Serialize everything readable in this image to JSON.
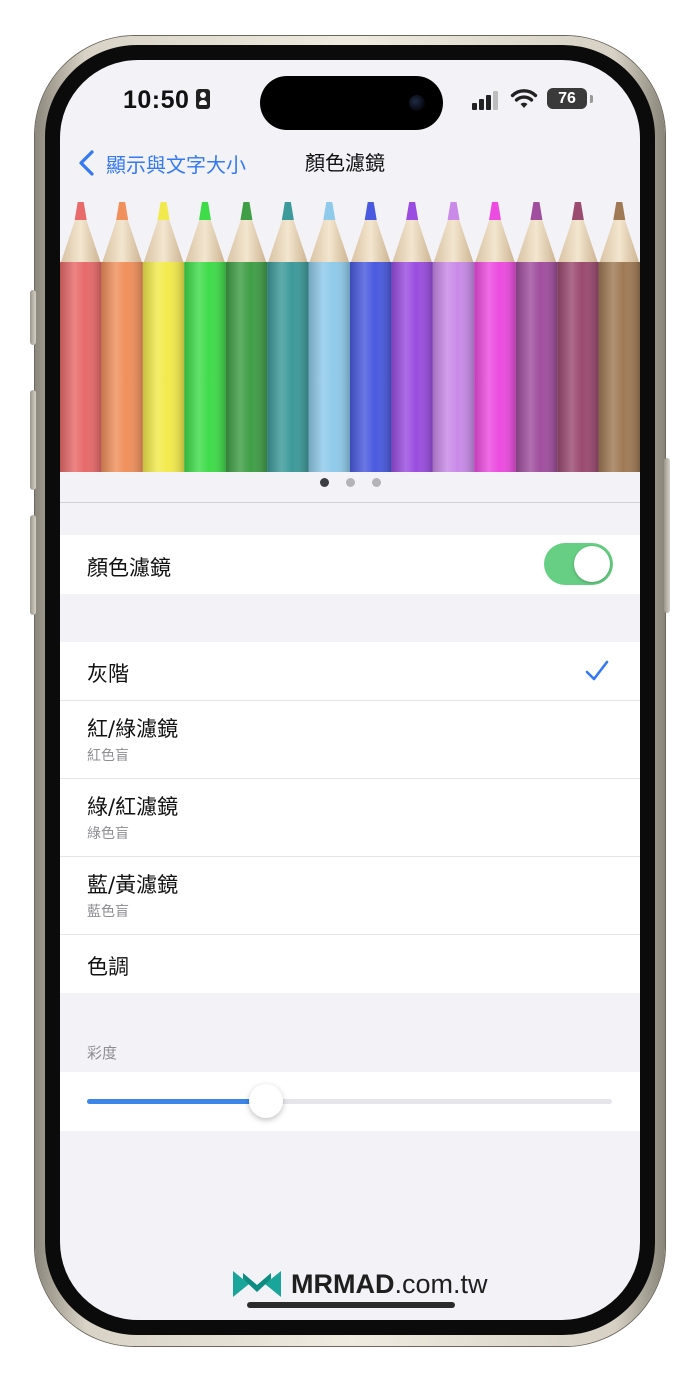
{
  "status_bar": {
    "time": "10:50",
    "battery": "76",
    "icons": [
      "person-id-icon",
      "cellular-signal-icon",
      "wifi-icon",
      "battery-icon"
    ]
  },
  "nav": {
    "back_label": "顯示與文字大小",
    "title": "顏色濾鏡"
  },
  "pencils": {
    "colors": [
      "#e86a6a",
      "#f0905c",
      "#f2ea4c",
      "#3fdc4a",
      "#3f9e46",
      "#3d9a9a",
      "#8fcaea",
      "#4a5ae0",
      "#9a4de0",
      "#c98ae8",
      "#ec4ce0",
      "#a04e9e",
      "#9b4a70",
      "#a07a55"
    ]
  },
  "pager": {
    "count": 3,
    "active": 0
  },
  "color_filters": {
    "label": "顏色濾鏡",
    "enabled": true
  },
  "filter_options": [
    {
      "label": "灰階",
      "sublabel": "",
      "selected": true
    },
    {
      "label": "紅/綠濾鏡",
      "sublabel": "紅色盲",
      "selected": false
    },
    {
      "label": "綠/紅濾鏡",
      "sublabel": "綠色盲",
      "selected": false
    },
    {
      "label": "藍/黃濾鏡",
      "sublabel": "藍色盲",
      "selected": false
    },
    {
      "label": "色調",
      "sublabel": "",
      "selected": false
    }
  ],
  "intensity": {
    "header": "彩度",
    "value": 0.34
  },
  "watermark": {
    "brand": "MRMAD",
    "suffix": ".com.tw"
  },
  "accent_color": "#3478f6",
  "toggle_color": "#67cf83"
}
